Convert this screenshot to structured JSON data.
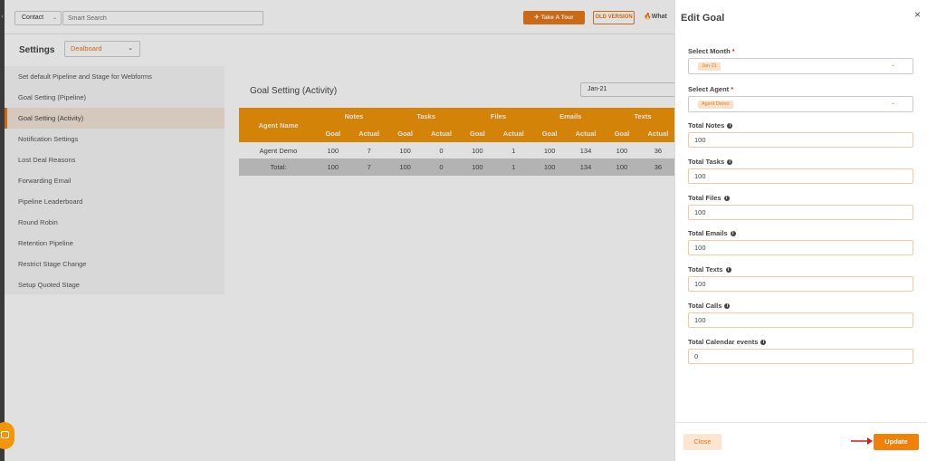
{
  "topbar": {
    "contact_label": "Contact",
    "search_placeholder": "Smart Search",
    "tour_label": "Take A Tour",
    "old_version_label": "OLD VERSION",
    "whats_label": "What"
  },
  "settings": {
    "title": "Settings",
    "board_select": "Dealboard"
  },
  "sidebar": {
    "items": [
      {
        "label": "Set default Pipeline and Stage for Webforms"
      },
      {
        "label": "Goal Setting (Pipeline)"
      },
      {
        "label": "Goal Setting (Activity)",
        "active": true
      },
      {
        "label": "Notification Settings"
      },
      {
        "label": "Lost Deal Reasons"
      },
      {
        "label": "Forwarding Email"
      },
      {
        "label": "Pipeline Leaderboard"
      },
      {
        "label": "Round Robin"
      },
      {
        "label": "Retention Pipeline"
      },
      {
        "label": "Restrict Stage Change"
      },
      {
        "label": "Setup Quoted Stage"
      }
    ]
  },
  "panel": {
    "title": "Goal Setting (Activity)",
    "month": "Jan-21",
    "table": {
      "agent_header": "Agent Name",
      "groups": [
        "Notes",
        "Tasks",
        "Files",
        "Emails",
        "Texts"
      ],
      "sub_goal": "Goal",
      "sub_actual": "Actual",
      "rows": [
        {
          "name": "Agent Demo",
          "values": [
            "100",
            "7",
            "100",
            "0",
            "100",
            "1",
            "100",
            "134",
            "100",
            "36"
          ]
        }
      ],
      "total": {
        "name": "Total:",
        "values": [
          "100",
          "7",
          "100",
          "0",
          "100",
          "1",
          "100",
          "134",
          "100",
          "36"
        ]
      }
    }
  },
  "drawer": {
    "title": "Edit Goal",
    "close_icon": "×",
    "month_label": "Select Month",
    "month_value": "Jan-21",
    "agent_label": "Select Agent",
    "agent_value": "Agent Demo",
    "required_mark": "*",
    "fields": [
      {
        "label": "Total Notes",
        "value": "100"
      },
      {
        "label": "Total Tasks",
        "value": "100"
      },
      {
        "label": "Total Files",
        "value": "100"
      },
      {
        "label": "Total Emails",
        "value": "100"
      },
      {
        "label": "Total Texts",
        "value": "100"
      },
      {
        "label": "Total Calls",
        "value": "100"
      },
      {
        "label": "Total Calendar events",
        "value": "0"
      }
    ],
    "close_label": "Close",
    "update_label": "Update"
  },
  "colors": {
    "accent": "#e8791a",
    "table_header": "#f0960a",
    "total_row": "#cccccc"
  }
}
